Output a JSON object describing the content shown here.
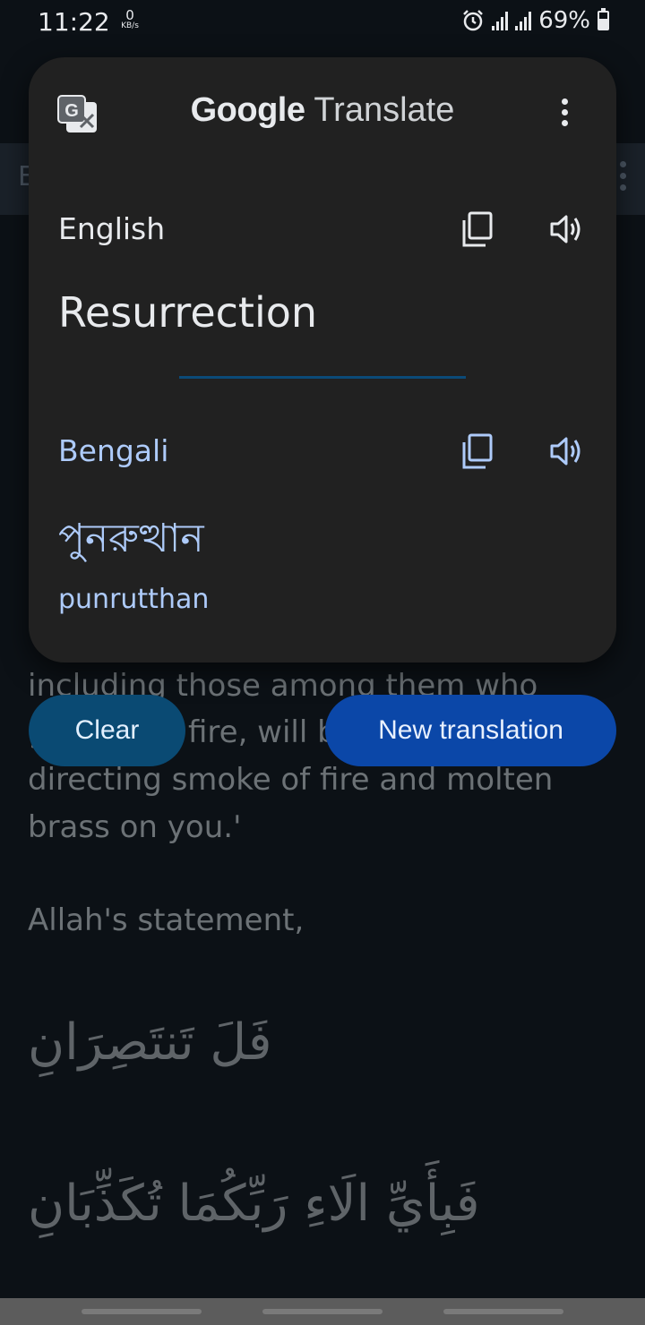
{
  "status_bar": {
    "time": "11:22",
    "net_speed_value": "0",
    "net_speed_unit": "KB/s",
    "battery_percent": "69%",
    "icons": [
      "alarm-icon",
      "signal-icon",
      "signal-icon",
      "battery-icon"
    ]
  },
  "background_page": {
    "toolbar_letter": "E",
    "text_line_1": "including those among them who",
    "text_line_2_left": "g",
    "text_line_2_mid": "fire, will b",
    "text_line_3": "directing smoke of fire and molten",
    "text_line_4": "brass on you.'",
    "statement": "Allah's statement,",
    "arabic_1": "فَلَ تَنتَصِرَانِ",
    "arabic_2": "فَبِأَيِّ الَاءِ رَبِّكُمَا تُكَذِّبَانِ"
  },
  "translate_popup": {
    "brand_google": "Google",
    "brand_translate": "Translate",
    "source": {
      "language": "English",
      "text": "Resurrection"
    },
    "target": {
      "language": "Bengali",
      "text": "পুনরুত্থান",
      "transliteration": "punrutthan"
    },
    "accent_color": "#aecbfa",
    "divider_color": "#0b4a78"
  },
  "buttons": {
    "clear": "Clear",
    "new_translation": "New translation"
  }
}
